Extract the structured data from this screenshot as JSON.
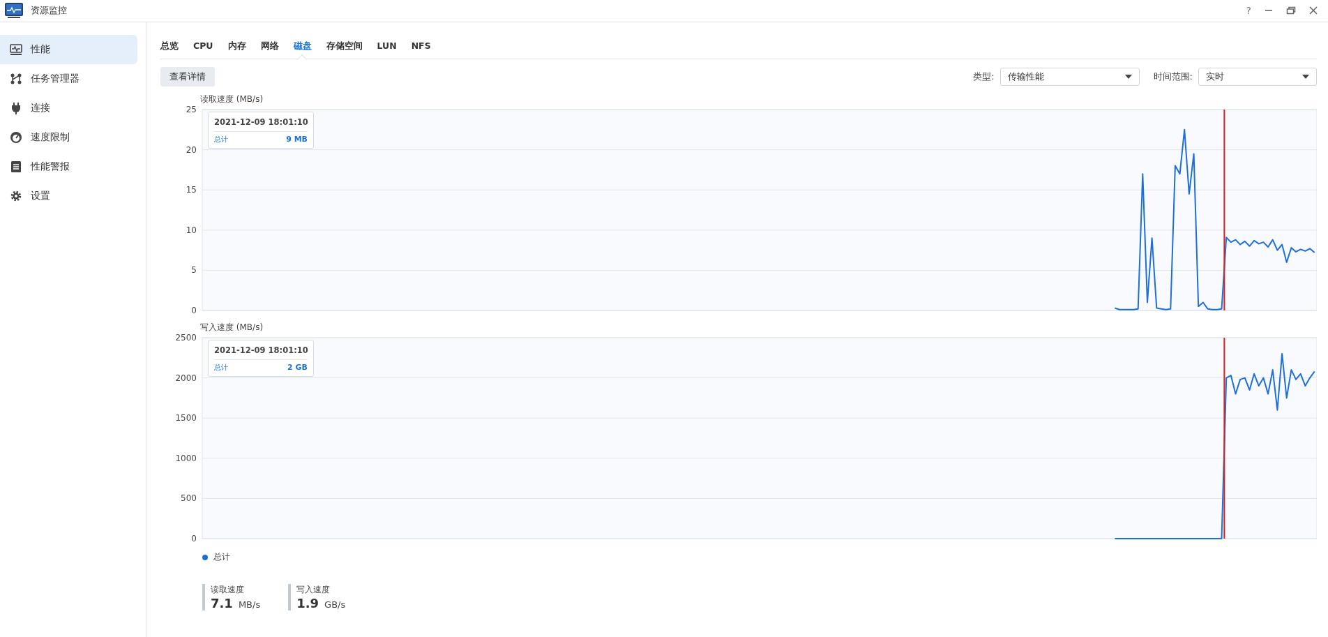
{
  "window": {
    "title": "资源监控",
    "help": "?"
  },
  "sidebar": {
    "items": [
      {
        "label": "性能",
        "kind": "performance",
        "selected": true
      },
      {
        "label": "任务管理器",
        "kind": "tasks",
        "selected": false
      },
      {
        "label": "连接",
        "kind": "plug",
        "selected": false
      },
      {
        "label": "速度限制",
        "kind": "gauge",
        "selected": false
      },
      {
        "label": "性能警报",
        "kind": "report",
        "selected": false
      },
      {
        "label": "设置",
        "kind": "settings",
        "selected": false
      }
    ]
  },
  "tabs": [
    {
      "label": "总览",
      "selected": false
    },
    {
      "label": "CPU",
      "selected": false
    },
    {
      "label": "内存",
      "selected": false
    },
    {
      "label": "网络",
      "selected": false
    },
    {
      "label": "磁盘",
      "selected": true
    },
    {
      "label": "存储空间",
      "selected": false
    },
    {
      "label": "LUN",
      "selected": false
    },
    {
      "label": "NFS",
      "selected": false
    }
  ],
  "toolbar": {
    "details_button": "查看详情",
    "filters": [
      {
        "label": "类型:",
        "value": "传输性能"
      },
      {
        "label": "时间范围:",
        "value": "实时"
      }
    ]
  },
  "charts": [
    {
      "tooltip": {
        "time": "2021-12-09 18:01:10",
        "value": "9 MB"
      },
      "chart_data": {
        "type": "line",
        "ylabel": "读取速度 (MB/s)",
        "ylim": [
          0,
          25
        ],
        "yticks": [
          0,
          5,
          10,
          15,
          20,
          25
        ],
        "grid": true,
        "series": [
          {
            "name": "总计",
            "color": "#1e6fd9",
            "values": [
              null,
              null,
              null,
              null,
              null,
              null,
              null,
              null,
              null,
              null,
              null,
              null,
              null,
              null,
              null,
              null,
              null,
              null,
              null,
              null,
              null,
              null,
              null,
              null,
              null,
              null,
              null,
              null,
              null,
              null,
              null,
              null,
              null,
              null,
              null,
              null,
              null,
              null,
              null,
              null,
              null,
              null,
              null,
              null,
              null,
              null,
              null,
              null,
              null,
              null,
              null,
              null,
              null,
              null,
              null,
              null,
              null,
              null,
              null,
              null,
              null,
              null,
              null,
              null,
              null,
              null,
              null,
              null,
              null,
              null,
              null,
              null,
              null,
              null,
              null,
              null,
              null,
              null,
              null,
              null,
              null,
              null,
              null,
              null,
              null,
              null,
              null,
              null,
              null,
              null,
              null,
              null,
              null,
              null,
              null,
              null,
              null,
              null,
              null,
              null,
              null,
              null,
              null,
              null,
              null,
              null,
              null,
              null,
              null,
              null,
              null,
              null,
              null,
              null,
              null,
              null,
              null,
              null,
              null,
              null,
              null,
              null,
              null,
              null,
              null,
              null,
              null,
              null,
              null,
              null,
              null,
              null,
              null,
              null,
              null,
              null,
              null,
              null,
              null,
              null,
              null,
              null,
              null,
              null,
              null,
              null,
              null,
              null,
              null,
              null,
              null,
              null,
              null,
              null,
              null,
              null,
              null,
              null,
              null,
              null,
              null,
              null,
              null,
              null,
              null,
              null,
              null,
              null,
              null,
              null,
              null,
              null,
              null,
              null,
              null,
              null,
              null,
              null,
              null,
              null,
              null,
              null,
              null,
              null,
              null,
              null,
              null,
              null,
              null,
              null,
              null,
              null,
              null,
              null,
              null,
              null,
              0.3,
              0.1,
              0.1,
              0.1,
              0.1,
              0.2,
              17,
              1,
              9,
              0.3,
              0.2,
              0.1,
              0.2,
              18,
              17,
              22.5,
              14.5,
              19.5,
              0.5,
              1,
              0.2,
              0.1,
              0.1,
              0.2,
              9.1,
              8.5,
              8.8,
              8.2,
              8.6,
              8.0,
              8.7,
              8.3,
              8.5,
              7.9,
              8.8,
              7.5,
              8.2,
              6.0,
              7.8,
              7.3,
              7.6,
              7.4,
              7.7,
              7.2
            ]
          }
        ]
      }
    },
    {
      "tooltip": {
        "time": "2021-12-09 18:01:10",
        "value": "2 GB"
      },
      "chart_data": {
        "type": "line",
        "ylabel": "写入速度 (MB/s)",
        "ylim": [
          0,
          2500
        ],
        "yticks": [
          0,
          500,
          1000,
          1500,
          2000,
          2500
        ],
        "grid": true,
        "series": [
          {
            "name": "总计",
            "color": "#1e6fd9",
            "values": [
              null,
              null,
              null,
              null,
              null,
              null,
              null,
              null,
              null,
              null,
              null,
              null,
              null,
              null,
              null,
              null,
              null,
              null,
              null,
              null,
              null,
              null,
              null,
              null,
              null,
              null,
              null,
              null,
              null,
              null,
              null,
              null,
              null,
              null,
              null,
              null,
              null,
              null,
              null,
              null,
              null,
              null,
              null,
              null,
              null,
              null,
              null,
              null,
              null,
              null,
              null,
              null,
              null,
              null,
              null,
              null,
              null,
              null,
              null,
              null,
              null,
              null,
              null,
              null,
              null,
              null,
              null,
              null,
              null,
              null,
              null,
              null,
              null,
              null,
              null,
              null,
              null,
              null,
              null,
              null,
              null,
              null,
              null,
              null,
              null,
              null,
              null,
              null,
              null,
              null,
              null,
              null,
              null,
              null,
              null,
              null,
              null,
              null,
              null,
              null,
              null,
              null,
              null,
              null,
              null,
              null,
              null,
              null,
              null,
              null,
              null,
              null,
              null,
              null,
              null,
              null,
              null,
              null,
              null,
              null,
              null,
              null,
              null,
              null,
              null,
              null,
              null,
              null,
              null,
              null,
              null,
              null,
              null,
              null,
              null,
              null,
              null,
              null,
              null,
              null,
              null,
              null,
              null,
              null,
              null,
              null,
              null,
              null,
              null,
              null,
              null,
              null,
              null,
              null,
              null,
              null,
              null,
              null,
              null,
              null,
              null,
              null,
              null,
              null,
              null,
              null,
              null,
              null,
              null,
              null,
              null,
              null,
              null,
              null,
              null,
              null,
              null,
              null,
              null,
              null,
              null,
              null,
              null,
              null,
              null,
              null,
              null,
              null,
              null,
              null,
              null,
              null,
              null,
              null,
              null,
              null,
              0,
              0,
              0,
              0,
              0,
              0,
              0,
              0,
              0,
              0,
              0,
              0,
              0,
              0,
              0,
              0,
              0,
              0,
              0,
              0,
              0,
              0,
              0,
              0,
              2000,
              2030,
              1800,
              1980,
              2000,
              1850,
              2050,
              1900,
              2000,
              1800,
              2100,
              1600,
              2300,
              1750,
              2100,
              1980,
              2050,
              1900,
              2000,
              2080
            ]
          }
        ]
      }
    }
  ],
  "stats": [
    {
      "label": "读取速度",
      "value": "7.1",
      "unit": "MB/s"
    },
    {
      "label": "写入速度",
      "value": "1.9",
      "unit": "GB/s"
    }
  ]
}
